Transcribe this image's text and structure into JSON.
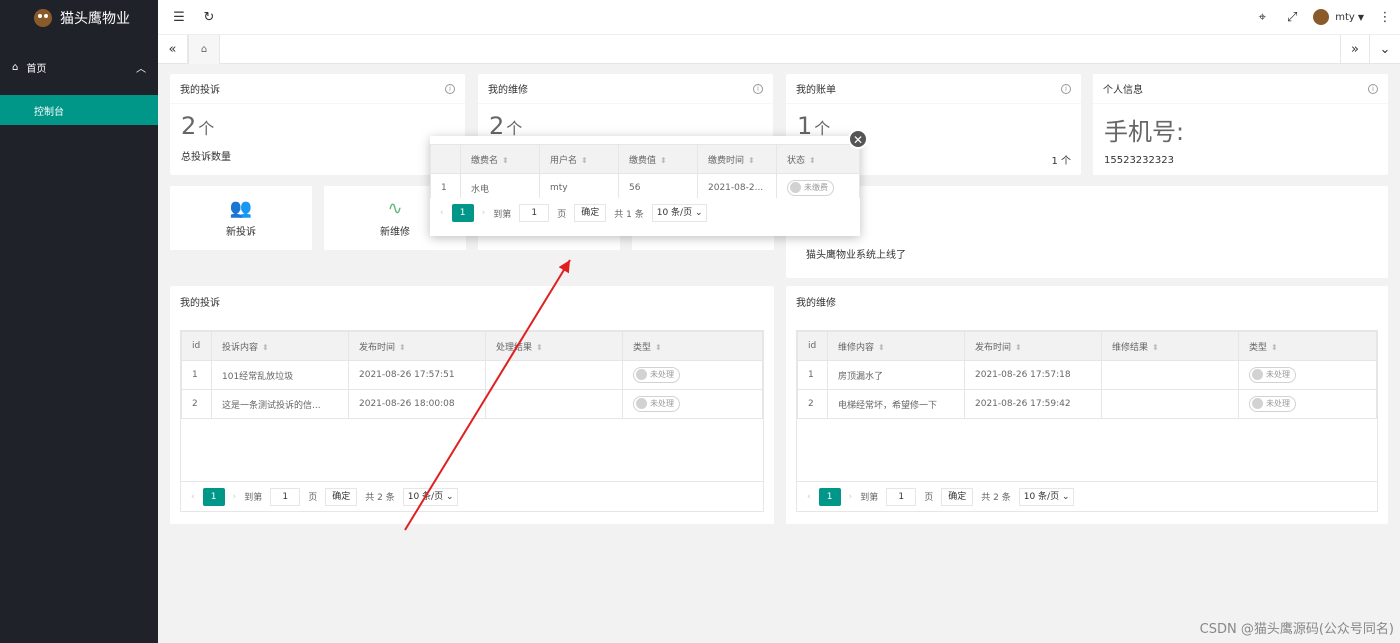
{
  "app": {
    "title": "猫头鹰物业",
    "user": "mty"
  },
  "sidebar": {
    "home": "首页",
    "console": "控制台"
  },
  "stats": [
    {
      "title": "我的投诉",
      "value": "2",
      "unit": "个",
      "sub": "总投诉数量"
    },
    {
      "title": "我的维修",
      "value": "2",
      "unit": "个",
      "sub": ""
    },
    {
      "title": "我的账单",
      "value": "1",
      "unit": "个",
      "sub": "",
      "right": "1 个"
    },
    {
      "title": "个人信息",
      "value": "手机号:",
      "unit": "",
      "sub": "15523232323"
    }
  ],
  "quick": {
    "complaint": "新投诉",
    "repair": "新维修"
  },
  "notice": {
    "text": "猫头鹰物业系统上线了"
  },
  "complaints": {
    "title": "我的投诉",
    "columns": [
      "id",
      "投诉内容",
      "发布时间",
      "处理结果",
      "类型"
    ],
    "rows": [
      {
        "id": "1",
        "content": "101经常乱放垃圾",
        "time": "2021-08-26 17:57:51",
        "result": "",
        "status": "未处理"
      },
      {
        "id": "2",
        "content": "这是一条测试投诉的信...",
        "time": "2021-08-26 18:00:08",
        "result": "",
        "status": "未处理"
      }
    ],
    "pager": {
      "page": "1",
      "goto": "到第",
      "input": "1",
      "unit": "页",
      "ok": "确定",
      "total": "共 2 条",
      "size": "10 条/页"
    }
  },
  "repairs": {
    "title": "我的维修",
    "columns": [
      "id",
      "维修内容",
      "发布时间",
      "维修结果",
      "类型"
    ],
    "rows": [
      {
        "id": "1",
        "content": "房顶漏水了",
        "time": "2021-08-26 17:57:18",
        "result": "",
        "status": "未处理"
      },
      {
        "id": "2",
        "content": "电梯经常坏，希望修一下",
        "time": "2021-08-26 17:59:42",
        "result": "",
        "status": "未处理"
      }
    ],
    "pager": {
      "page": "1",
      "goto": "到第",
      "input": "1",
      "unit": "页",
      "ok": "确定",
      "total": "共 2 条",
      "size": "10 条/页"
    }
  },
  "popup": {
    "columns": [
      "",
      "缴费名",
      "用户名",
      "缴费值",
      "缴费时间",
      "状态"
    ],
    "rows": [
      {
        "n": "1",
        "name": "水电",
        "user": "mty",
        "value": "56",
        "time": "2021-08-2...",
        "status": "未缴费"
      }
    ],
    "pager": {
      "page": "1",
      "goto": "到第",
      "input": "1",
      "unit": "页",
      "ok": "确定",
      "total": "共 1 条",
      "size": "10 条/页"
    }
  },
  "watermark": "CSDN @猫头鹰源码(公众号同名)",
  "colors": {
    "accent": "#009688",
    "sidebar": "#20222a",
    "arrow": "#e02020"
  }
}
